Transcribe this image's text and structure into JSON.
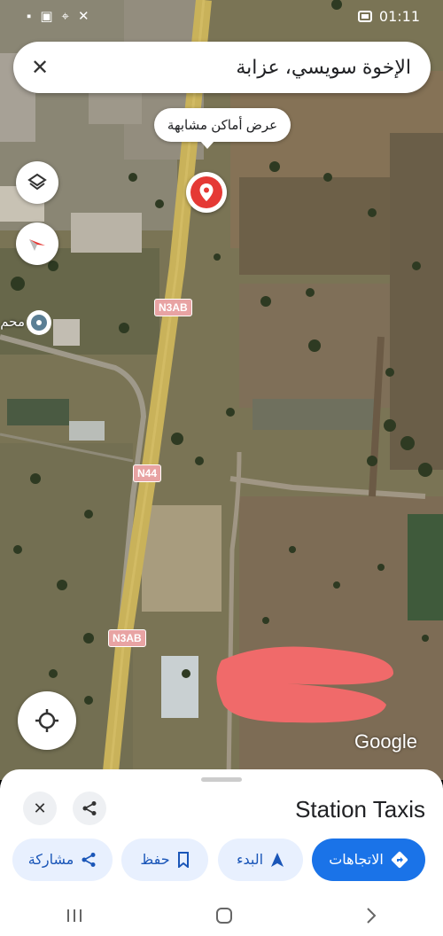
{
  "status_bar": {
    "time": "01:11"
  },
  "search": {
    "query": "الإخوة سويسي، عزابة"
  },
  "map": {
    "similar_places_chip": "عرض أماكن مشابهة",
    "poi_label": "محم",
    "road_labels": [
      "N3AB",
      "N44",
      "N3AB"
    ],
    "attribution": "Google",
    "colors": {
      "pin": "#e53935",
      "road": "#c9b25a",
      "redaction": "#f06a6a"
    }
  },
  "sheet": {
    "title": "Station Taxis",
    "actions": {
      "directions": "الاتجاهات",
      "start": "البدء",
      "save": "حفظ",
      "share": "مشاركة"
    }
  },
  "icons": [
    "close-icon",
    "layers-icon",
    "compass-icon",
    "locate-icon",
    "share-icon",
    "directions-icon",
    "navigation-icon",
    "bookmark-icon",
    "recents-icon",
    "home-icon",
    "back-icon"
  ]
}
